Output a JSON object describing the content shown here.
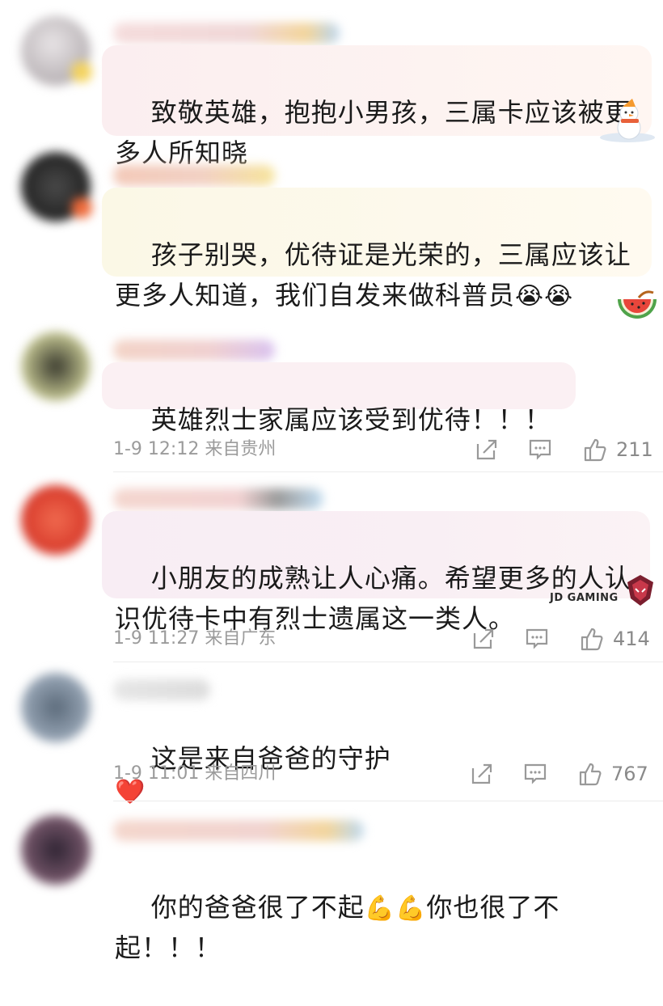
{
  "comments": [
    {
      "text": "致敬英雄，抱抱小男孩，三属卡应该被更\n多人所知晓",
      "deco": "snowman"
    },
    {
      "text": "孩子别哭，优待证是光荣的，三属应该让\n更多人知道，我们自发来做科普员",
      "emoji_tail": "😭😭",
      "deco": "watermelon"
    },
    {
      "text": "英雄烈士家属应该受到优待！！！",
      "time": "1-9 12:12",
      "location": "来自贵州",
      "likes": "211"
    },
    {
      "text": "小朋友的成熟让人心痛。希望更多的人认\n识优待卡中有烈士遗属这一类人。",
      "deco_text": "JD GAMING",
      "time": "1-9 11:27",
      "location": "来自广东",
      "likes": "414"
    },
    {
      "text": "这是来自爸爸的守护",
      "emoji_tail": "❤️",
      "time": "1-9 11:01",
      "location": "来自四川",
      "likes": "767"
    },
    {
      "text_a": "你的爸爸很了不起",
      "emoji_mid": "💪💪",
      "text_b": "你也很了不",
      "text_c": "起！！！"
    }
  ],
  "icons": {
    "share": "share-icon",
    "comment": "comment-icon",
    "like": "thumbs-up-icon"
  },
  "colors": {
    "meta_text": "#9b9b9b",
    "bubble_1": "#fbeef0",
    "bubble_2": "#fbf8e6",
    "bubble_3": "#f8edf4"
  }
}
